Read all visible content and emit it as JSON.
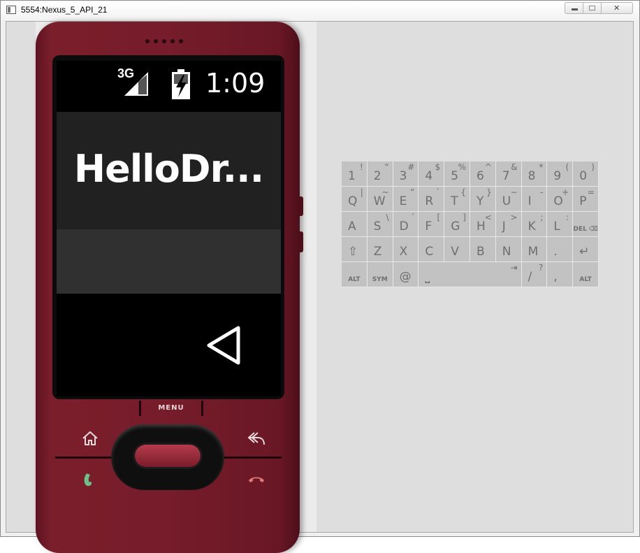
{
  "window": {
    "title": "5554:Nexus_5_API_21"
  },
  "status_bar": {
    "network": "3G",
    "time": "1:09"
  },
  "app": {
    "title": "HelloDr..."
  },
  "hardware": {
    "menu_label": "MENU"
  },
  "keyboard": {
    "rows": [
      [
        {
          "main": "1",
          "alt": "!"
        },
        {
          "main": "2",
          "alt": "“"
        },
        {
          "main": "3",
          "alt": "#"
        },
        {
          "main": "4",
          "alt": "$"
        },
        {
          "main": "5",
          "alt": "%"
        },
        {
          "main": "6",
          "alt": "^"
        },
        {
          "main": "7",
          "alt": "&"
        },
        {
          "main": "8",
          "alt": "*"
        },
        {
          "main": "9",
          "alt": "("
        },
        {
          "main": "0",
          "alt": ")"
        }
      ],
      [
        {
          "main": "Q",
          "alt": "|"
        },
        {
          "main": "W",
          "alt": "~"
        },
        {
          "main": "E",
          "alt": "“"
        },
        {
          "main": "R",
          "alt": "`"
        },
        {
          "main": "T",
          "alt": "{"
        },
        {
          "main": "Y",
          "alt": "}"
        },
        {
          "main": "U",
          "alt": "−"
        },
        {
          "main": "I",
          "alt": "-"
        },
        {
          "main": "O",
          "alt": "+"
        },
        {
          "main": "P",
          "alt": "="
        }
      ],
      [
        {
          "main": "A",
          "alt": ""
        },
        {
          "main": "S",
          "alt": "\\"
        },
        {
          "main": "D",
          "alt": "´"
        },
        {
          "main": "F",
          "alt": "["
        },
        {
          "main": "G",
          "alt": "]"
        },
        {
          "main": "H",
          "alt": "<"
        },
        {
          "main": "J",
          "alt": ">"
        },
        {
          "main": "K",
          "alt": ";"
        },
        {
          "main": "L",
          "alt": ":"
        },
        {
          "main": "",
          "alt": "",
          "small": "DEL ⌫"
        }
      ],
      [
        {
          "main": "⇧",
          "alt": ""
        },
        {
          "main": "Z",
          "alt": ""
        },
        {
          "main": "X",
          "alt": ""
        },
        {
          "main": "C",
          "alt": ""
        },
        {
          "main": "V",
          "alt": ""
        },
        {
          "main": "B",
          "alt": ""
        },
        {
          "main": "N",
          "alt": ""
        },
        {
          "main": "M",
          "alt": ""
        },
        {
          "main": ".",
          "alt": ""
        },
        {
          "main": "↵",
          "alt": ""
        }
      ]
    ],
    "bottom": {
      "alt_left": "ALT",
      "sym": "SYM",
      "at": "@",
      "space": "⎵",
      "tab": "⇥",
      "slash": "/",
      "question": "?",
      "comma": ",",
      "alt_right": "ALT"
    }
  },
  "colors": {
    "phone_body": "#761c2a",
    "keyboard_key": "#c2c2c2",
    "action_bar": "#212121"
  }
}
